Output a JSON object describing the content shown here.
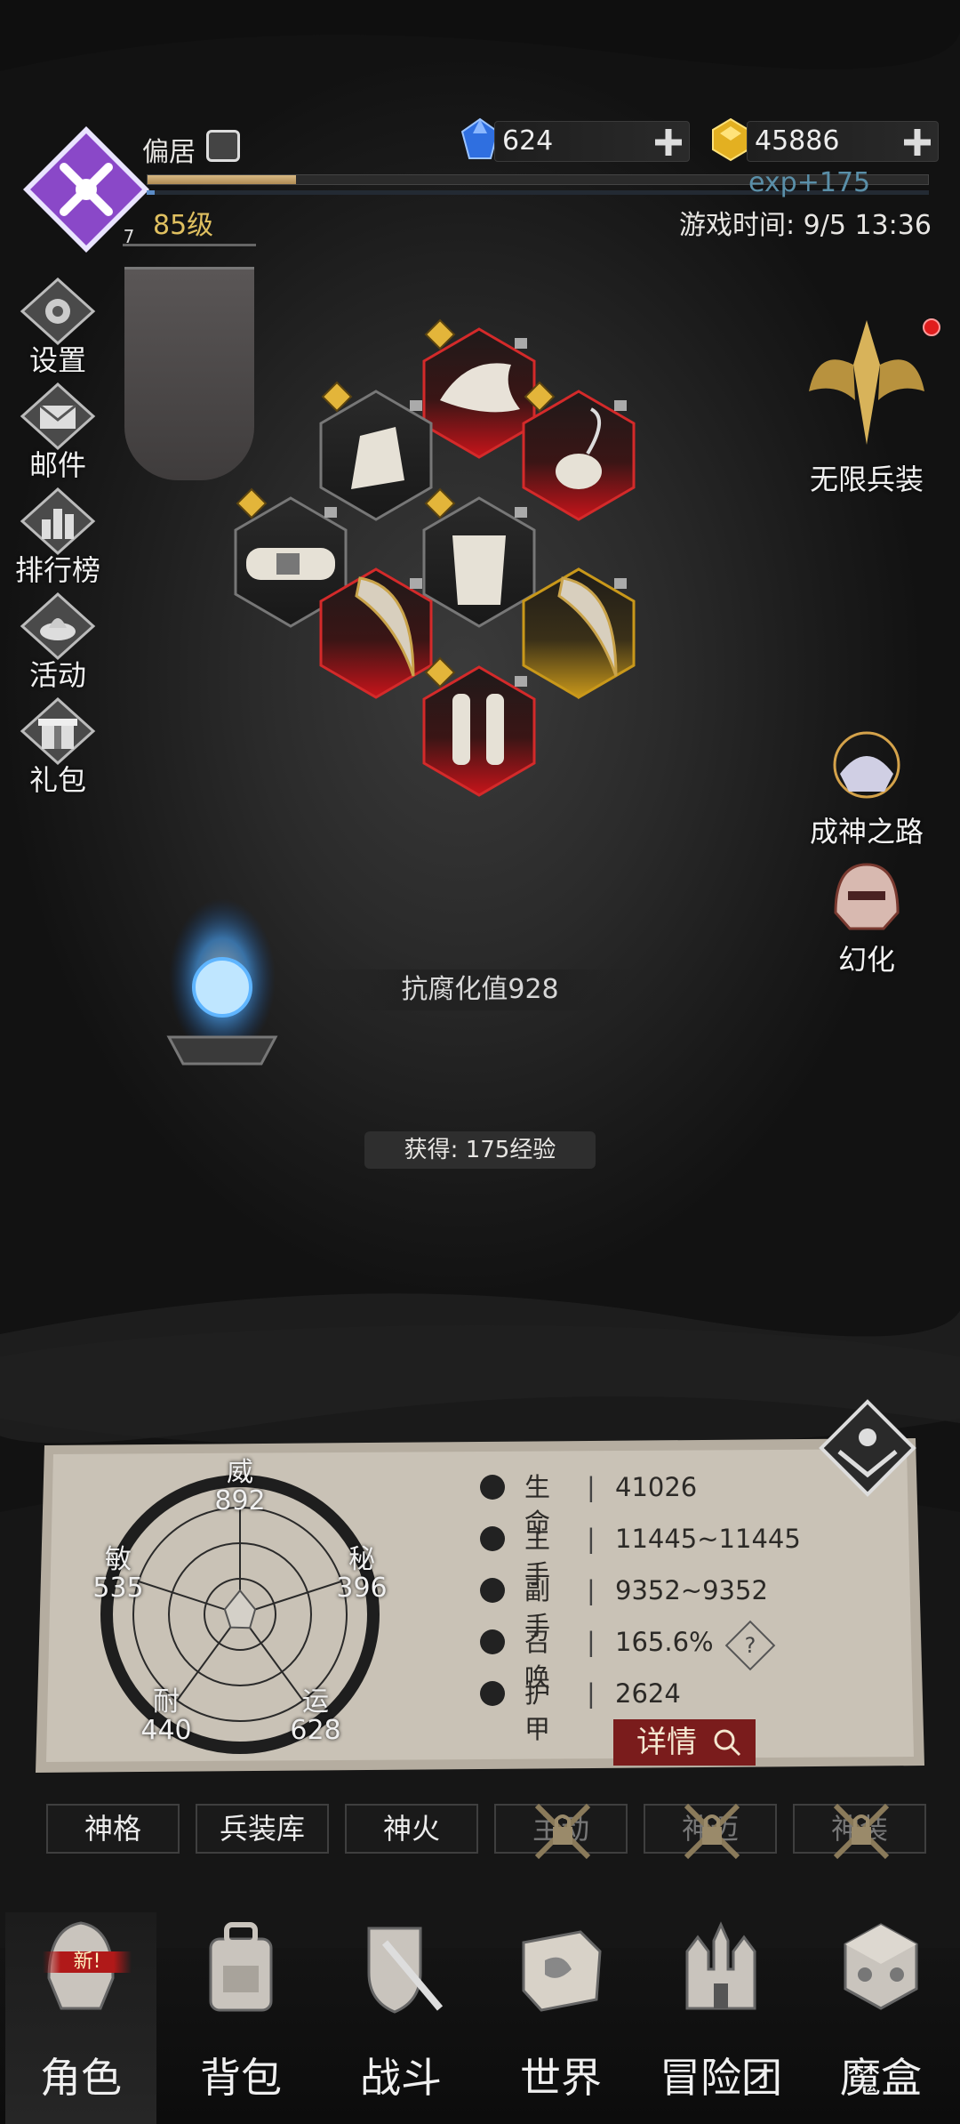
{
  "player": {
    "name": "偏居",
    "level": "85级",
    "rank_badge": "7",
    "exp_gain": "exp+175",
    "game_time": "游戏时间: 9/5 13:36",
    "xp_fraction": 0.19,
    "sub_fraction": 0.01
  },
  "currency": {
    "gems": "624",
    "gold": "45886"
  },
  "side_menu": {
    "settings": "设置",
    "mail": "邮件",
    "ranking": "排行榜",
    "events": "活动",
    "gift": "礼包"
  },
  "right_menu": {
    "infinite_arms": "无限兵装",
    "godhood_path": "成神之路",
    "transform": "幻化"
  },
  "center": {
    "corruption": "抗腐化值928",
    "gain": "获得: 175经验"
  },
  "radar": {
    "wei_label": "威",
    "wei_value": "892",
    "mi_label": "秘",
    "mi_value": "396",
    "yun_label": "运",
    "yun_value": "628",
    "nai_label": "耐",
    "nai_value": "440",
    "min_label": "敏",
    "min_value": "535"
  },
  "stats": {
    "hp_label": "生命",
    "hp_value": "41026",
    "main_label": "主手",
    "main_value": "11445~11445",
    "off_label": "副手",
    "off_value": "9352~9352",
    "summon_label": "召唤",
    "summon_value": "165.6%",
    "armor_label": "护甲",
    "armor_value": "2624",
    "detail_button": "详情",
    "help": "?"
  },
  "tabs": {
    "godhood": "神格",
    "armory": "兵装库",
    "godfire": "神火",
    "tab4": "主动",
    "tab5": "神迈",
    "tab6": "神装"
  },
  "nav": {
    "character": "角色",
    "bag": "背包",
    "battle": "战斗",
    "world": "世界",
    "guild": "冒险团",
    "magicbox": "魔盒",
    "new_badge": "新!"
  },
  "colors": {
    "accent_gold": "#e0c060",
    "exp_blue": "#5a8fa8",
    "danger_red": "#b01919"
  }
}
